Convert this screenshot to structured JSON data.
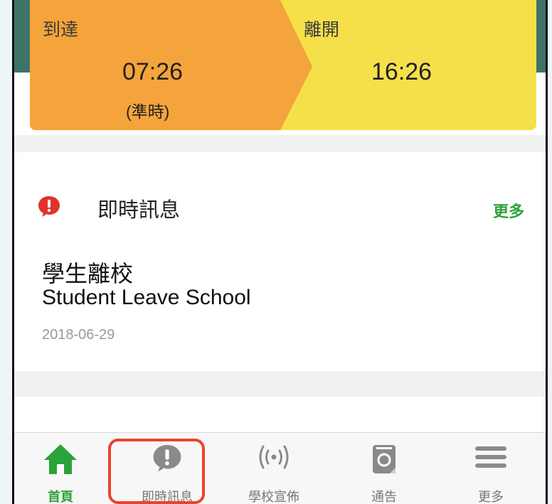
{
  "attendance": {
    "arrive_label": "到達",
    "arrive_time": "07:26",
    "arrive_status": "(準時)",
    "leave_label": "離開",
    "leave_time": "16:26",
    "colors": {
      "arrive": "#f4a43a",
      "leave": "#f5e04a"
    }
  },
  "instant_messages": {
    "title": "即時訊息",
    "more_label": "更多",
    "icon": "alert-bubble-icon",
    "items": [
      {
        "title_zh": "學生離校",
        "title_en": "Student Leave School",
        "date": "2018-06-29"
      }
    ]
  },
  "tabbar": {
    "items": [
      {
        "label": "首頁",
        "icon": "home-icon",
        "active": true
      },
      {
        "label": "即時訊息",
        "icon": "alert-bubble-icon",
        "active": false
      },
      {
        "label": "學校宣佈",
        "icon": "broadcast-icon",
        "active": false
      },
      {
        "label": "通告",
        "icon": "notice-icon",
        "active": false
      },
      {
        "label": "更多",
        "icon": "menu-icon",
        "active": false
      }
    ]
  },
  "colors": {
    "accent": "#2aa33a",
    "alert_red": "#e0322b",
    "highlight": "#e8442c"
  }
}
